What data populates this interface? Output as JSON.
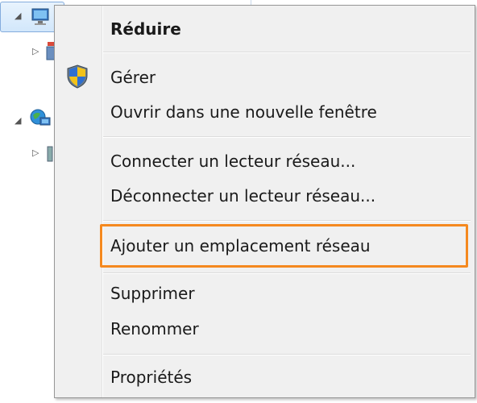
{
  "menu": {
    "items": [
      {
        "label": "Réduire",
        "bold": true
      },
      {
        "label": "Gérer",
        "icon": "uac-shield-icon"
      },
      {
        "label": "Ouvrir dans une nouvelle fenêtre"
      },
      {
        "label": "Connecter un lecteur réseau..."
      },
      {
        "label": "Déconnecter un lecteur réseau..."
      },
      {
        "label": "Ajouter un emplacement réseau",
        "highlighted": true
      },
      {
        "label": "Supprimer"
      },
      {
        "label": "Renommer"
      },
      {
        "label": "Propriétés"
      }
    ]
  },
  "tree": {
    "icons": [
      "computer-icon",
      "drive-icon",
      "network-icon",
      "folder-icon"
    ]
  },
  "colors": {
    "highlight_border": "#f5891f",
    "menu_bg": "#f0f0f0",
    "selection_bg": "#d2e7fb"
  }
}
